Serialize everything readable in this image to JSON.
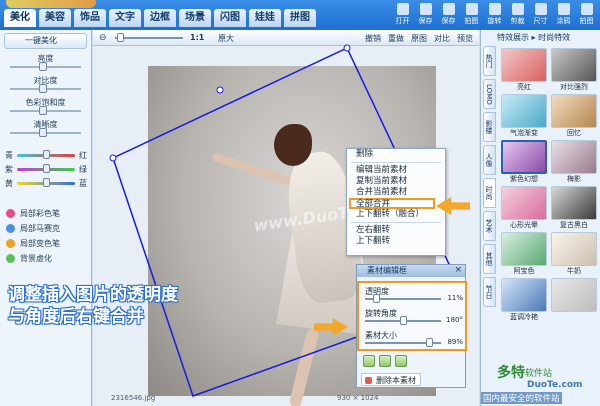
{
  "tabs": [
    "美化",
    "美容",
    "饰品",
    "文字",
    "边框",
    "场景",
    "闪图",
    "娃娃",
    "拼图"
  ],
  "tabs_badge": "新",
  "toolbar": [
    "打开",
    "保存",
    "保存",
    "拍图",
    "旋转",
    "剪裁",
    "尺寸",
    "涂鸦",
    "拍图"
  ],
  "left": {
    "one_click": "一键美化",
    "sliders": [
      {
        "label": "亮度",
        "value": 0.5
      },
      {
        "label": "对比度",
        "value": 0.5
      },
      {
        "label": "色彩饱和度",
        "value": 0.5
      },
      {
        "label": "清晰度",
        "value": 0.5
      }
    ],
    "color_rows": [
      {
        "l": "青",
        "r": "红",
        "value": 0.5,
        "colors": [
          "#3cc8d8",
          "#e83b3b"
        ]
      },
      {
        "l": "紫",
        "r": "绿",
        "value": 0.5,
        "colors": [
          "#c23ad6",
          "#3ccf4a"
        ]
      },
      {
        "l": "黄",
        "r": "蓝",
        "value": 0.5,
        "colors": [
          "#f2d62c",
          "#2d6fe0"
        ]
      }
    ],
    "tools": [
      {
        "label": "局部彩色笔",
        "color": "#e84a8c"
      },
      {
        "label": "局部马赛克",
        "color": "#4a90e2"
      },
      {
        "label": "局部变色笔",
        "color": "#f0a020"
      },
      {
        "label": "背景虚化",
        "color": "#5ac05a"
      }
    ]
  },
  "canvas": {
    "zoom_pct": "1:1",
    "zoom_orig": "原大",
    "actions": [
      "撤销",
      "重做",
      "原图",
      "对比",
      "预览"
    ],
    "watermark": "www.DuoTe.com",
    "status_left": "2316546.jpg",
    "status_right": "930 × 1024"
  },
  "context_menu": {
    "items": [
      "删除",
      "编辑当前素材",
      "复制当前素材",
      "合并当前素材",
      "全部合并",
      "上下翻转（融合）",
      "左右翻转",
      "上下翻转"
    ]
  },
  "dialog": {
    "title": "素材编辑框",
    "close": "×",
    "rows": [
      {
        "label": "透明度",
        "value": 0.11,
        "display": "11%"
      },
      {
        "label": "旋转角度",
        "value": 0.5,
        "display": "180°"
      },
      {
        "label": "素材大小",
        "value": 0.89,
        "display": "89%"
      }
    ],
    "delete_label": "删除本素材"
  },
  "annotation": {
    "line1": "调整插入图片的透明度",
    "line2": "与角度后右键合并"
  },
  "right": {
    "header": "特效展示 ▸ 时尚特效",
    "vtabs": [
      "热门",
      "LOMO",
      "影楼",
      "人像",
      "时尚",
      "艺术",
      "其他",
      "节日"
    ],
    "thumbs": [
      {
        "cap": "亮红",
        "c1": "#f2c8c8",
        "c2": "#d96060"
      },
      {
        "cap": "对比强烈",
        "c1": "#c9c9c9",
        "c2": "#555555"
      },
      {
        "cap": "气泡渐变",
        "c1": "#c7ecf5",
        "c2": "#4aa8c8"
      },
      {
        "cap": "回忆",
        "c1": "#f3dcc0",
        "c2": "#b58650"
      },
      {
        "cap": "紫色幻想",
        "c1": "#e6c8f0",
        "c2": "#8c4aa8"
      },
      {
        "cap": "梅影",
        "c1": "#e8dfe6",
        "c2": "#9a7c8e"
      },
      {
        "cap": "心形光晕",
        "c1": "#f5d0e0",
        "c2": "#d86c9a"
      },
      {
        "cap": "复古黑白",
        "c1": "#d8d8d8",
        "c2": "#3a3a3a"
      },
      {
        "cap": "阿宝色",
        "c1": "#d8efe0",
        "c2": "#5aa872"
      },
      {
        "cap": "牛奶",
        "c1": "#faf4ec",
        "c2": "#cdbfae"
      },
      {
        "cap": "蓝调冷艳",
        "c1": "#d6e6f6",
        "c2": "#4a78b8"
      },
      {
        "cap": "",
        "c1": "#e8e8e8",
        "c2": "#bdbdbd"
      }
    ]
  },
  "site": {
    "name": "多特",
    "sub": "软件站",
    "url": "DuoTe.com",
    "slogan": "国内最安全的软件站"
  }
}
